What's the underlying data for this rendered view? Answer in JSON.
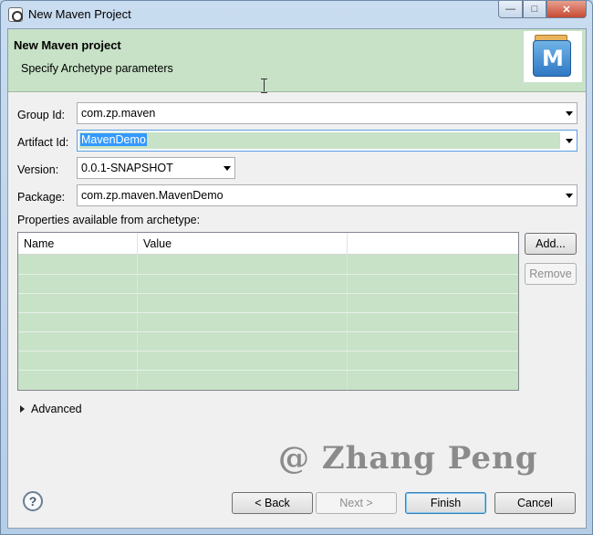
{
  "window": {
    "title": "New Maven Project"
  },
  "banner": {
    "title": "New Maven project",
    "description": "Specify Archetype parameters",
    "logo_letter": "M"
  },
  "form": {
    "group_id": {
      "label": "Group Id:",
      "value": "com.zp.maven"
    },
    "artifact_id": {
      "label": "Artifact Id:",
      "value": "MavenDemo"
    },
    "version": {
      "label": "Version:",
      "value": "0.0.1-SNAPSHOT"
    },
    "package": {
      "label": "Package:",
      "value": "com.zp.maven.MavenDemo"
    }
  },
  "properties": {
    "label": "Properties available from archetype:",
    "columns": [
      "Name",
      "Value",
      ""
    ],
    "rows": []
  },
  "side_buttons": {
    "add": "Add...",
    "remove": "Remove"
  },
  "advanced": {
    "label": "Advanced"
  },
  "watermark": "@ Zhang Peng",
  "footer": {
    "back": "< Back",
    "next": "Next >",
    "finish": "Finish",
    "cancel": "Cancel"
  },
  "colors": {
    "banner_bg": "#c7e2c7",
    "selection": "#3399ff",
    "table_bg": "#c7e2c7"
  },
  "icons": [
    "eclipse-app-icon",
    "minimize-icon",
    "maximize-icon",
    "close-icon",
    "maven-logo",
    "help-icon",
    "expand-arrow-icon"
  ]
}
